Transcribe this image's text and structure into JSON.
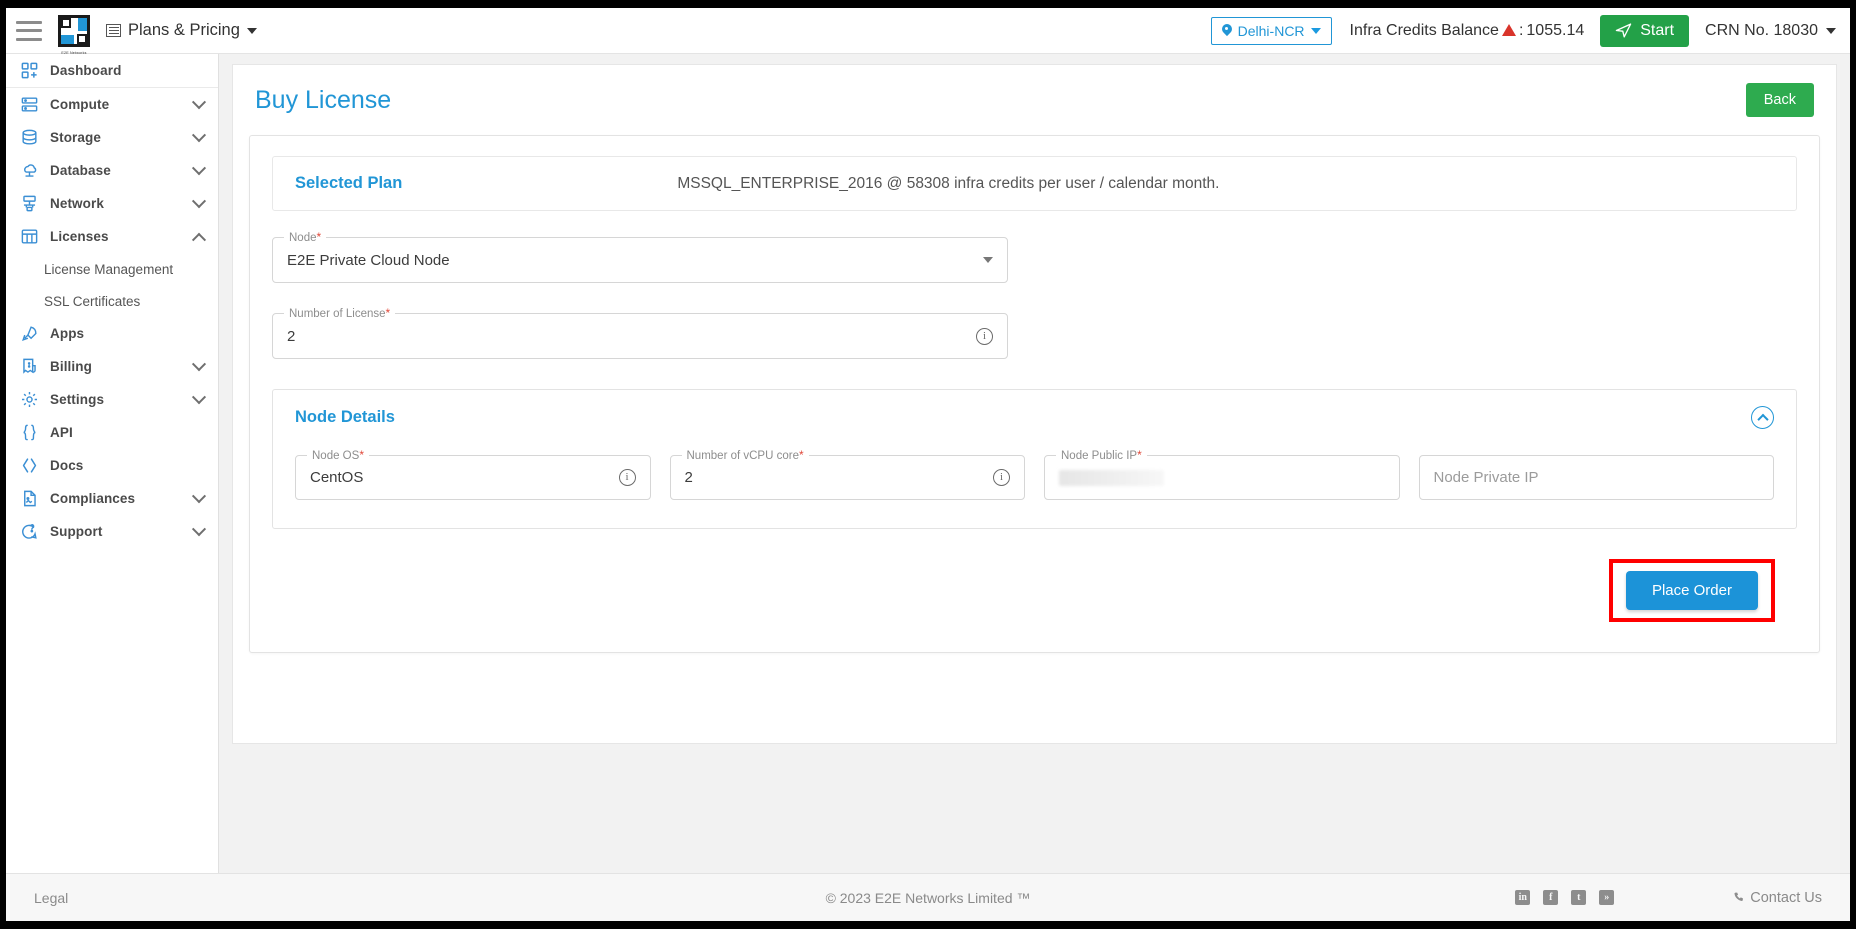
{
  "topbar": {
    "menu_icon": "hamburger-icon",
    "brand": "E2E Networks",
    "plans_label": "Plans & Pricing",
    "region": "Delhi-NCR",
    "credits_label": "Infra Credits Balance",
    "credits_separator": ": ",
    "credits_value": "1055.14",
    "start_label": "Start",
    "crn_label": "CRN No. 18030"
  },
  "sidebar": {
    "items": [
      {
        "label": "Dashboard",
        "icon": "dashboard-icon",
        "expandable": false
      },
      {
        "label": "Compute",
        "icon": "server-icon",
        "expandable": true,
        "expanded": false
      },
      {
        "label": "Storage",
        "icon": "database-disk-icon",
        "expandable": true,
        "expanded": false
      },
      {
        "label": "Database",
        "icon": "cloud-database-icon",
        "expandable": true,
        "expanded": false
      },
      {
        "label": "Network",
        "icon": "network-icon",
        "expandable": true,
        "expanded": false
      },
      {
        "label": "Licenses",
        "icon": "licenses-grid-icon",
        "expandable": true,
        "expanded": true
      },
      {
        "label": "Apps",
        "icon": "rocket-icon",
        "expandable": false
      },
      {
        "label": "Billing",
        "icon": "billing-invoice-icon",
        "expandable": true,
        "expanded": false
      },
      {
        "label": "Settings",
        "icon": "gear-icon",
        "expandable": true,
        "expanded": false
      },
      {
        "label": "API",
        "icon": "braces-icon",
        "expandable": false
      },
      {
        "label": "Docs",
        "icon": "angle-brackets-icon",
        "expandable": false
      },
      {
        "label": "Compliances",
        "icon": "document-icon",
        "expandable": true,
        "expanded": false
      },
      {
        "label": "Support",
        "icon": "support-chat-icon",
        "expandable": true,
        "expanded": false
      }
    ],
    "licenses_sub": [
      {
        "label": "License Management"
      },
      {
        "label": "SSL Certificates"
      }
    ]
  },
  "page": {
    "title": "Buy License",
    "back_label": "Back"
  },
  "selected_plan": {
    "label": "Selected Plan",
    "value": "MSSQL_ENTERPRISE_2016 @ 58308 infra credits per user / calendar month."
  },
  "form": {
    "node": {
      "label": "Node",
      "required": "*",
      "value": "E2E Private Cloud Node"
    },
    "number_of_license": {
      "label": "Number of License",
      "required": "*",
      "value": "2"
    }
  },
  "node_details": {
    "title": "Node Details",
    "fields": [
      {
        "label": "Node OS",
        "required": "*",
        "value": "CentOS",
        "has_info": true,
        "masked": false,
        "placeholder": ""
      },
      {
        "label": "Number of vCPU core",
        "required": "*",
        "value": "2",
        "has_info": true,
        "masked": false,
        "placeholder": ""
      },
      {
        "label": "Node Public IP",
        "required": "*",
        "value": "",
        "has_info": false,
        "masked": true,
        "placeholder": ""
      },
      {
        "label": "",
        "required": "",
        "value": "",
        "has_info": false,
        "masked": false,
        "placeholder": "Node Private IP"
      }
    ]
  },
  "actions": {
    "place_order_label": "Place Order",
    "highlight_color": "#ff0000"
  },
  "footer": {
    "legal": "Legal",
    "copyright": "© 2023 E2E Networks Limited ™",
    "social": [
      {
        "name": "linkedin-icon",
        "glyph": "in"
      },
      {
        "name": "facebook-icon",
        "glyph": "f"
      },
      {
        "name": "twitter-icon",
        "glyph": "t"
      },
      {
        "name": "rss-icon",
        "glyph": "»"
      }
    ],
    "contact": "Contact Us"
  },
  "colors": {
    "accent_blue": "#2196d6",
    "green": "#2eab4f",
    "start_green": "#23a148",
    "danger_red": "#d9342b"
  }
}
